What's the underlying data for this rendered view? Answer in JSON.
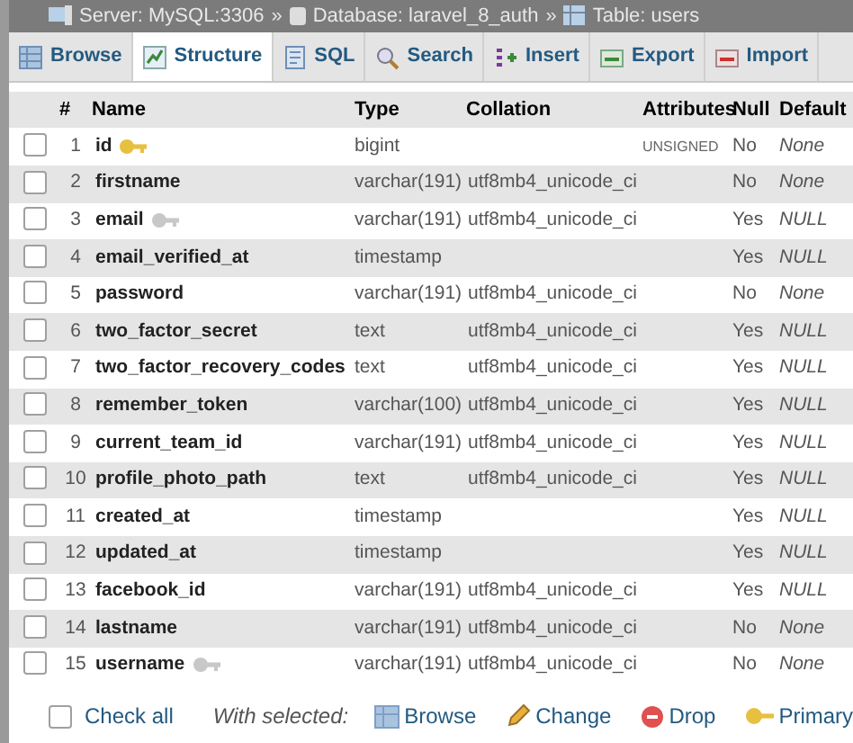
{
  "breadcrumb": [
    {
      "kind": "server",
      "label": "Server: MySQL:3306"
    },
    {
      "kind": "database",
      "label": "Database: laravel_8_auth"
    },
    {
      "kind": "table",
      "label": "Table: users"
    }
  ],
  "separator": "»",
  "tabs": [
    {
      "kind": "browse",
      "label": "Browse",
      "selected": false
    },
    {
      "kind": "structure",
      "label": "Structure",
      "selected": true
    },
    {
      "kind": "sql",
      "label": "SQL",
      "selected": false
    },
    {
      "kind": "search",
      "label": "Search",
      "selected": false
    },
    {
      "kind": "insert",
      "label": "Insert",
      "selected": false
    },
    {
      "kind": "export",
      "label": "Export",
      "selected": false
    },
    {
      "kind": "import",
      "label": "Import",
      "selected": false
    }
  ],
  "table": {
    "columns": [
      "#",
      "Name",
      "Type",
      "Collation",
      "Attributes",
      "Null",
      "Default"
    ],
    "rows": [
      {
        "checked": false,
        "num": "1",
        "name": "id",
        "kind": "primary_key",
        "type": "bigint",
        "collation": "",
        "attributes": "UNSIGNED",
        "null": "No",
        "default": "None"
      },
      {
        "checked": false,
        "num": "2",
        "name": "firstname",
        "kind": "plain",
        "type": "varchar(191)",
        "collation": "utf8mb4_unicode_ci",
        "attributes": "",
        "null": "No",
        "default": "None"
      },
      {
        "checked": false,
        "num": "3",
        "name": "email",
        "kind": "unique_key",
        "type": "varchar(191)",
        "collation": "utf8mb4_unicode_ci",
        "attributes": "",
        "null": "Yes",
        "default": "NULL"
      },
      {
        "checked": false,
        "num": "4",
        "name": "email_verified_at",
        "kind": "plain",
        "type": "timestamp",
        "collation": "",
        "attributes": "",
        "null": "Yes",
        "default": "NULL"
      },
      {
        "checked": false,
        "num": "5",
        "name": "password",
        "kind": "plain",
        "type": "varchar(191)",
        "collation": "utf8mb4_unicode_ci",
        "attributes": "",
        "null": "No",
        "default": "None"
      },
      {
        "checked": false,
        "num": "6",
        "name": "two_factor_secret",
        "kind": "plain",
        "type": "text",
        "collation": "utf8mb4_unicode_ci",
        "attributes": "",
        "null": "Yes",
        "default": "NULL"
      },
      {
        "checked": false,
        "num": "7",
        "name": "two_factor_recovery_codes",
        "kind": "plain",
        "type": "text",
        "collation": "utf8mb4_unicode_ci",
        "attributes": "",
        "null": "Yes",
        "default": "NULL"
      },
      {
        "checked": false,
        "num": "8",
        "name": "remember_token",
        "kind": "plain",
        "type": "varchar(100)",
        "collation": "utf8mb4_unicode_ci",
        "attributes": "",
        "null": "Yes",
        "default": "NULL"
      },
      {
        "checked": false,
        "num": "9",
        "name": "current_team_id",
        "kind": "plain",
        "type": "varchar(191)",
        "collation": "utf8mb4_unicode_ci",
        "attributes": "",
        "null": "Yes",
        "default": "NULL"
      },
      {
        "checked": false,
        "num": "10",
        "name": "profile_photo_path",
        "kind": "plain",
        "type": "text",
        "collation": "utf8mb4_unicode_ci",
        "attributes": "",
        "null": "Yes",
        "default": "NULL"
      },
      {
        "checked": false,
        "num": "11",
        "name": "created_at",
        "kind": "plain",
        "type": "timestamp",
        "collation": "",
        "attributes": "",
        "null": "Yes",
        "default": "NULL"
      },
      {
        "checked": false,
        "num": "12",
        "name": "updated_at",
        "kind": "plain",
        "type": "timestamp",
        "collation": "",
        "attributes": "",
        "null": "Yes",
        "default": "NULL"
      },
      {
        "checked": false,
        "num": "13",
        "name": "facebook_id",
        "kind": "plain",
        "type": "varchar(191)",
        "collation": "utf8mb4_unicode_ci",
        "attributes": "",
        "null": "Yes",
        "default": "NULL"
      },
      {
        "checked": false,
        "num": "14",
        "name": "lastname",
        "kind": "plain",
        "type": "varchar(191)",
        "collation": "utf8mb4_unicode_ci",
        "attributes": "",
        "null": "No",
        "default": "None"
      },
      {
        "checked": false,
        "num": "15",
        "name": "username",
        "kind": "unique_key",
        "type": "varchar(191)",
        "collation": "utf8mb4_unicode_ci",
        "attributes": "",
        "null": "No",
        "default": "None"
      }
    ]
  },
  "footer": {
    "check_all": {
      "label": "Check all",
      "checked": false
    },
    "with_selected": "With selected:",
    "actions": [
      {
        "kind": "browse",
        "label": "Browse"
      },
      {
        "kind": "change",
        "label": "Change"
      },
      {
        "kind": "drop",
        "label": "Drop"
      },
      {
        "kind": "primary",
        "label": "Primary"
      }
    ]
  }
}
